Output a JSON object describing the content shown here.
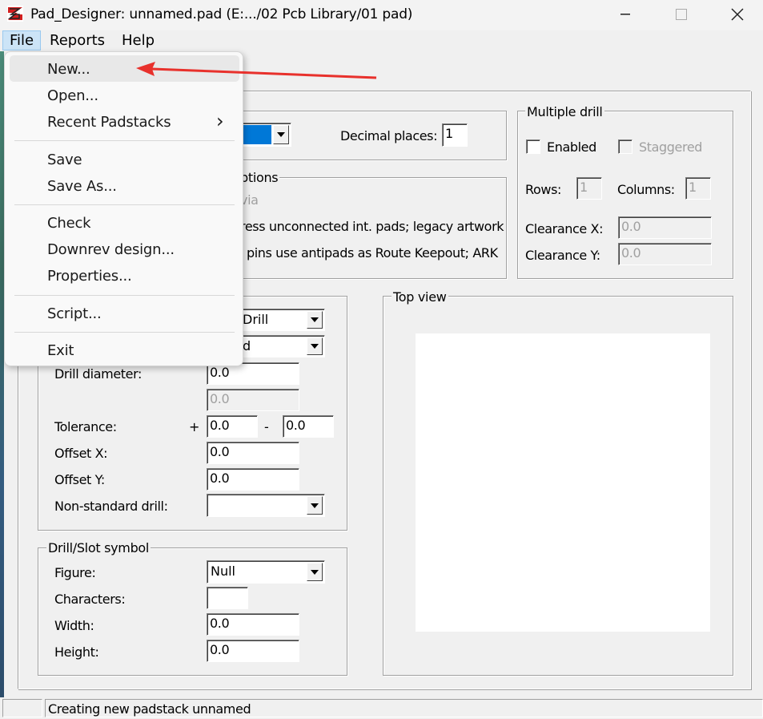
{
  "window": {
    "title": "Pad_Designer: unnamed.pad (E:.../02 Pcb Library/01 pad)",
    "minimize": "—",
    "maximize": "☐",
    "close": "✕"
  },
  "menubar": {
    "items": [
      "File",
      "Reports",
      "Help"
    ]
  },
  "file_menu": {
    "items": [
      {
        "label": "New..."
      },
      {
        "label": "Open..."
      },
      {
        "label": "Recent Padstacks",
        "submenu_arrow": "›"
      },
      {
        "label": "Save"
      },
      {
        "label": "Save As..."
      },
      {
        "label": "Check"
      },
      {
        "label": "Downrev design..."
      },
      {
        "label": "Properties..."
      },
      {
        "label": "Script..."
      },
      {
        "label": "Exit"
      }
    ],
    "highlighted": "New...",
    "annotation_arrow_color": "#e8312c"
  },
  "top_row": {
    "decimal_places_label": "Decimal places:",
    "decimal_places_value": "1",
    "units_selected": ""
  },
  "options_group": {
    "title_partial": "ptions",
    "opt1_partial": "via",
    "opt2_partial": "ress unconnected int. pads; legacy artwork",
    "opt3_partial": "pins use antipads as Route Keepout; ARK"
  },
  "multiple_drill": {
    "title": "Multiple drill",
    "enabled_label": "Enabled",
    "staggered_label": "Staggered",
    "rows_label": "Rows:",
    "rows_value": "1",
    "columns_label": "Columns:",
    "columns_value": "1",
    "clearance_x_label": "Clearance X:",
    "clearance_x_value": "0.0",
    "clearance_y_label": "Clearance Y:",
    "clearance_y_value": "0.0"
  },
  "drill_group": {
    "type_partial": "Drill",
    "plating_partial": "d",
    "drill_diameter_label": "Drill diameter:",
    "drill_diameter_value": "0.0",
    "drill_diameter_2_value": "0.0",
    "tolerance_label": "Tolerance:",
    "plus": "+",
    "minus": "-",
    "tol_plus_value": "0.0",
    "tol_minus_value": "0.0",
    "offset_x_label": "Offset X:",
    "offset_x_value": "0.0",
    "offset_y_label": "Offset Y:",
    "offset_y_value": "0.0",
    "nonstandard_label": "Non-standard drill:",
    "nonstandard_value": ""
  },
  "symbol_group": {
    "title": "Drill/Slot symbol",
    "figure_label": "Figure:",
    "figure_value": "Null",
    "characters_label": "Characters:",
    "characters_value": "",
    "width_label": "Width:",
    "width_value": "0.0",
    "height_label": "Height:",
    "height_value": "0.0"
  },
  "top_view": {
    "title": "Top view"
  },
  "status": {
    "message": "Creating new padstack unnamed"
  }
}
